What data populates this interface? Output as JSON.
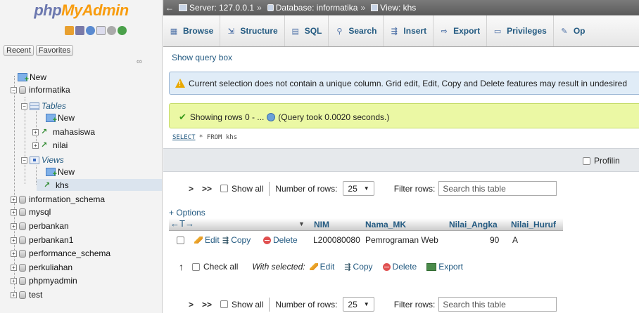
{
  "nav": {
    "logo_part1": "php",
    "logo_part2": "MyAdmin",
    "recent_label": "Recent",
    "favorites_label": "Favorites",
    "tree": {
      "new_root": "New",
      "db_informatika": "informatika",
      "tables_label": "Tables",
      "tables_new": "New",
      "table_mahasiswa": "mahasiswa",
      "table_nilai": "nilai",
      "views_label": "Views",
      "views_new": "New",
      "view_khs": "khs",
      "databases": [
        "information_schema",
        "mysql",
        "perbankan",
        "perbankan1",
        "performance_schema",
        "perkuliahan",
        "phpmyadmin",
        "test"
      ]
    }
  },
  "breadcrumb": {
    "server": "Server: 127.0.0.1",
    "database": "Database: informatika",
    "view": "View: khs"
  },
  "tabs": [
    "Browse",
    "Structure",
    "SQL",
    "Search",
    "Insert",
    "Export",
    "Privileges",
    "Op"
  ],
  "content": {
    "show_query": "Show query box",
    "warning": "Current selection does not contain a unique column. Grid edit, Edit, Copy and Delete features may result in undesired",
    "success_prefix": "Showing rows 0 - ...",
    "success_suffix": "(Query took 0.0020 seconds.)",
    "sql_select": "SELECT",
    "sql_star": " * ",
    "sql_from": "FROM",
    "sql_table": " khs",
    "profiling": "Profilin",
    "navrow": {
      "first": ">",
      "last": ">>",
      "show_all": "Show all",
      "rows_label": "Number of rows:",
      "rows_value": "25",
      "filter_label": "Filter rows:",
      "filter_placeholder": "Search this table"
    },
    "options": "+ Options",
    "columns": [
      "NIM",
      "Nama_MK",
      "Nilai_Angka",
      "Nilai_Huruf"
    ],
    "rows": [
      {
        "nim": "L200080080",
        "nama_mk": "Pemrograman Web",
        "nilai_angka": "90",
        "nilai_huruf": "A"
      }
    ],
    "row_actions": {
      "edit": "Edit",
      "copy": "Copy",
      "delete": "Delete"
    },
    "bulk": {
      "check_all": "Check all",
      "with_selected": "With selected:",
      "edit": "Edit",
      "copy": "Copy",
      "delete": "Delete",
      "export": "Export"
    }
  }
}
